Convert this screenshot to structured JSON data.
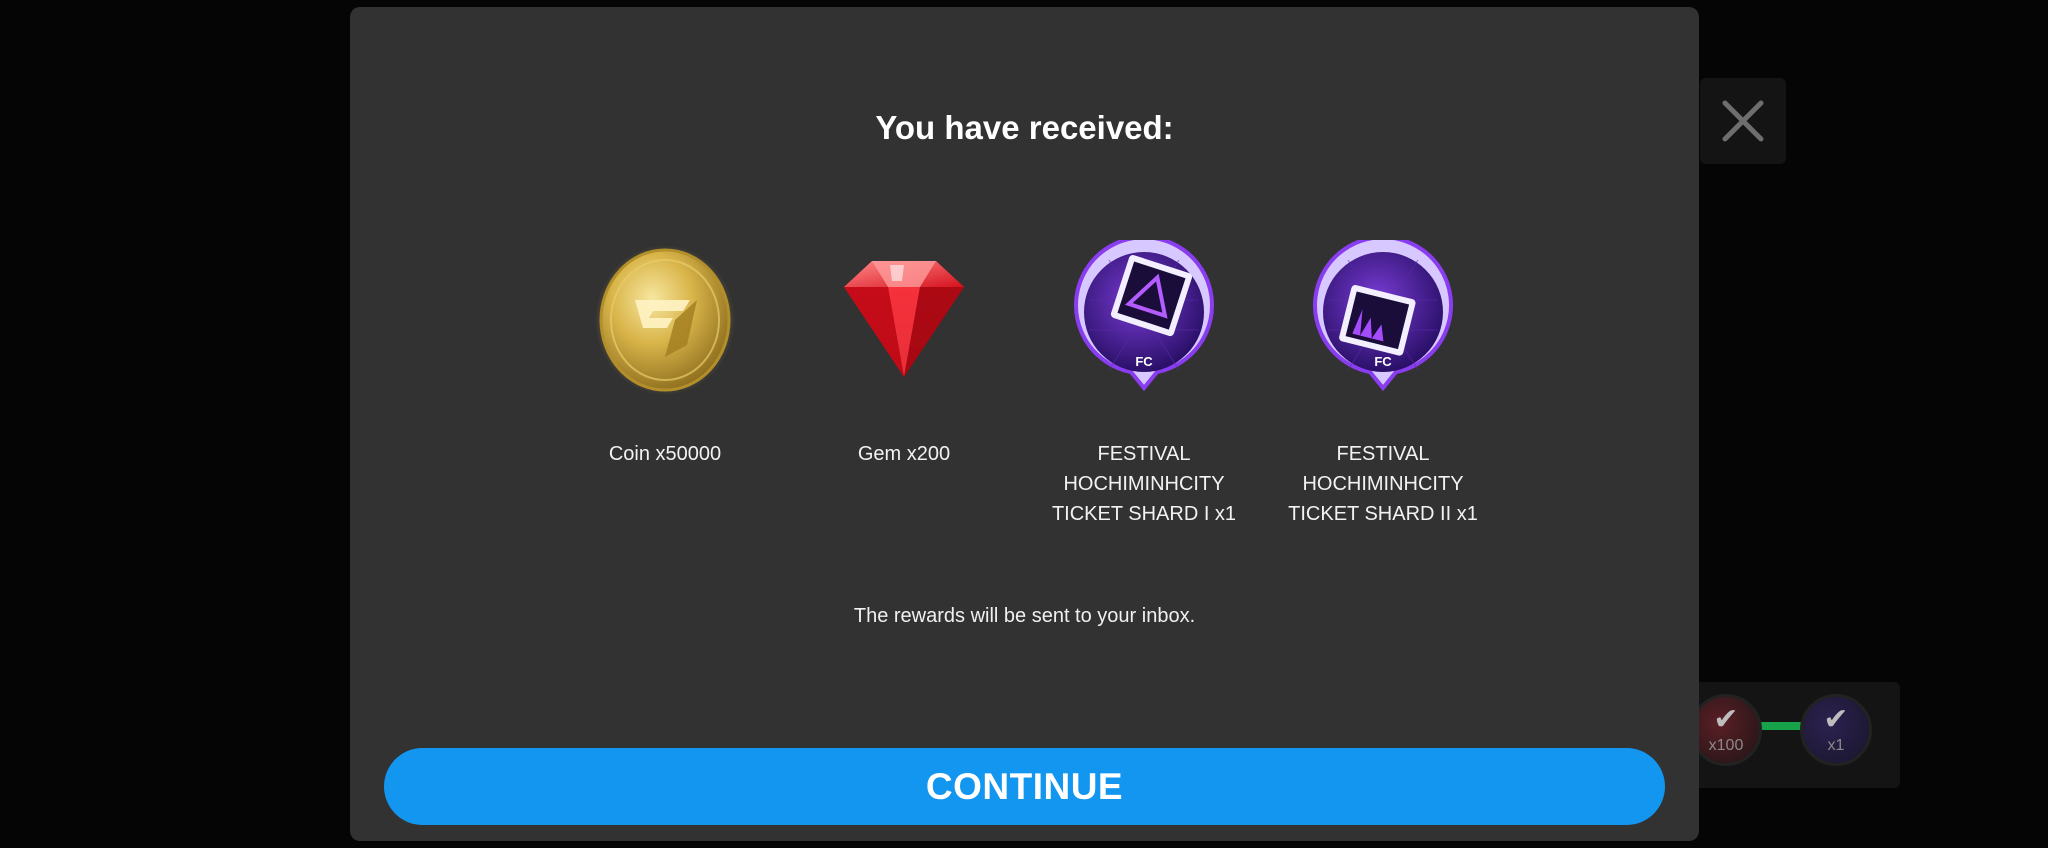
{
  "modal": {
    "title": "You have received:",
    "note": "The rewards will be sent to your inbox.",
    "continue_label": "CONTINUE"
  },
  "rewards": [
    {
      "label": "Coin x50000",
      "icon": "coin-icon"
    },
    {
      "label": "Gem x200",
      "icon": "gem-icon"
    },
    {
      "label": "FESTIVAL\nHOCHIMINHCITY\nTICKET SHARD I x1",
      "icon": "festival-ticket-shard-i-icon"
    },
    {
      "label": "FESTIVAL\nHOCHIMINHCITY\nTICKET SHARD II x1",
      "icon": "festival-ticket-shard-ii-icon"
    }
  ],
  "background": {
    "progress_labels": [
      "x100",
      "x1"
    ]
  },
  "colors": {
    "modal_bg": "#323232",
    "accent": "#1296f0",
    "page_bg": "#050505"
  }
}
